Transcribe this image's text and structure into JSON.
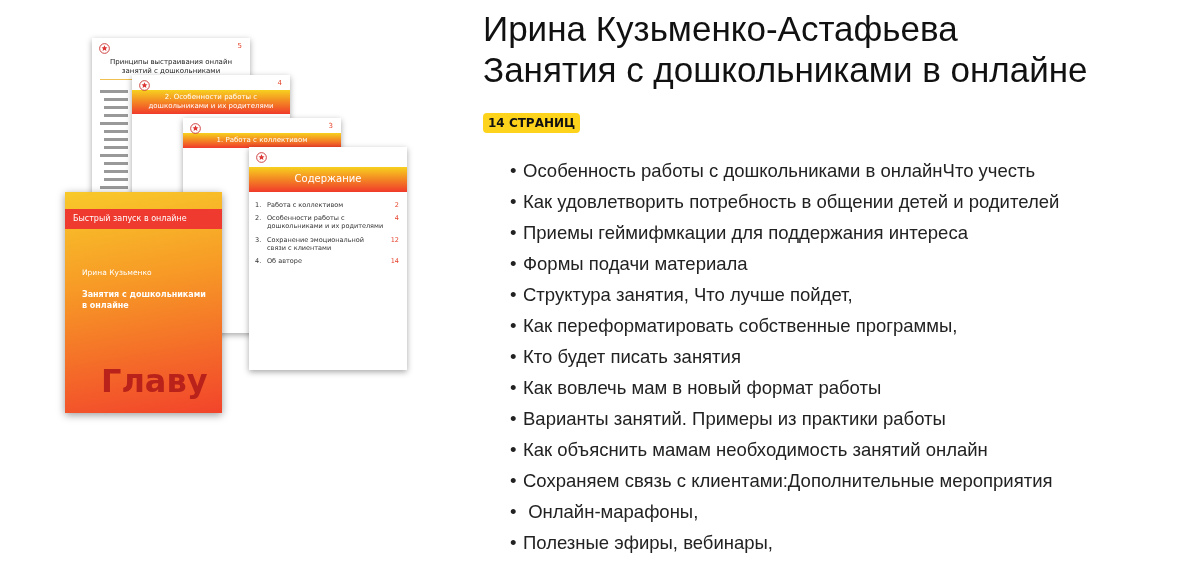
{
  "collage": {
    "pages": [
      {
        "kind": "text",
        "number": "5",
        "title": "Принципы выстраивания онлайн занятий с дошкольниками"
      },
      {
        "kind": "chapter",
        "number": "4",
        "title": "2. Особенности работы с дошкольниками и их родителями"
      },
      {
        "kind": "chapter",
        "number": "3",
        "title": "1. Работа с коллективом"
      },
      {
        "kind": "contents",
        "title": "Содержание",
        "entries": [
          {
            "index": "1.",
            "label": "Работа с коллективом",
            "page": "2"
          },
          {
            "index": "2.",
            "label": "Особенности работы с дошкольниками и их родителями",
            "page": "4"
          },
          {
            "index": "3.",
            "label": "Сохранение эмоциональной связи с клиентами",
            "page": "12"
          },
          {
            "index": "4.",
            "label": "Об авторе",
            "page": "14"
          }
        ]
      }
    ],
    "cover": {
      "series": "Быстрый запуск в онлайне",
      "author": "Ирина Кузьменко",
      "title": "Занятия с дошкольниками в онлайне",
      "mark": "Главу"
    }
  },
  "heading": {
    "author": "Ирина Кузьменко-Астафьева",
    "title": "Занятия с дошкольниками в онлайне"
  },
  "badge": "14 СТРАНИЦ",
  "topics": [
    {
      "marker": "•",
      "text": "Особенность работы с дошкольниками в онлайнЧто учесть"
    },
    {
      "marker": "•",
      "text": "Как удовлетворить потребность в общении детей и родителей"
    },
    {
      "marker": "•",
      "text": "Приемы геймифмкации для поддержания интереса"
    },
    {
      "marker": "•",
      "text": "Формы подачи материала"
    },
    {
      "marker": "•",
      "text": "Структура занятия, Что лучше пойдет,"
    },
    {
      "marker": "•",
      "text": "Как переформатировать собственные программы,"
    },
    {
      "marker": "•",
      "text": "Кто будет писать занятия"
    },
    {
      "marker": "•",
      "text": "Как вовлечь мам в новый формат работы"
    },
    {
      "marker": "•",
      "text": "Варианты занятий. Примеры из практики работы"
    },
    {
      "marker": "•",
      "text": "Как объяснить мамам необходимость занятий онлайн"
    },
    {
      "marker": "•",
      "text": "Сохраняем связь с клиентами:Дополнительные мероприятия"
    },
    {
      "marker": "•",
      "text": " Онлайн-марафоны,"
    },
    {
      "marker": "•",
      "text": "Полезные эфиры, вебинары,"
    }
  ]
}
